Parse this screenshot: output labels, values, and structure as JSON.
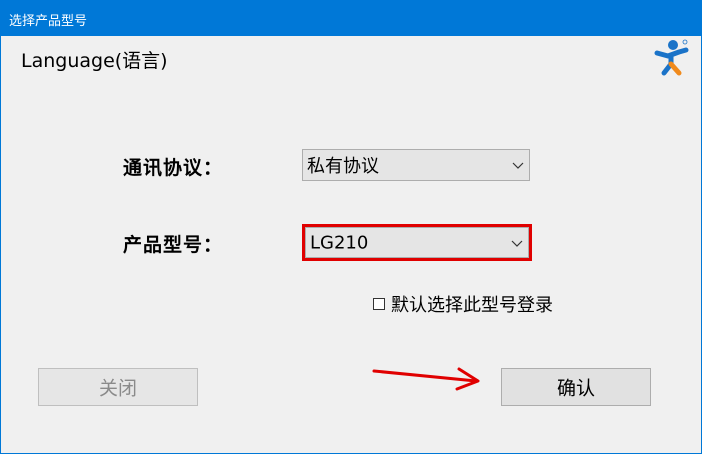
{
  "window": {
    "title": "选择产品型号"
  },
  "language_link": "Language(语言)",
  "form": {
    "protocol_label": "通讯协议：",
    "protocol_value": "私有协议",
    "model_label": "产品型号：",
    "model_value": "LG210",
    "remember_label": "默认选择此型号登录",
    "remember_checked": false
  },
  "buttons": {
    "close_label": "关闭",
    "confirm_label": "确认"
  },
  "colors": {
    "titlebar": "#0078d7",
    "highlight": "#e00000",
    "logo_blue": "#1a73c8",
    "logo_orange": "#f08a1c"
  },
  "icons": {
    "logo": "running-person-logo",
    "dropdown": "chevron-down-icon",
    "annotation": "red-arrow-icon"
  }
}
